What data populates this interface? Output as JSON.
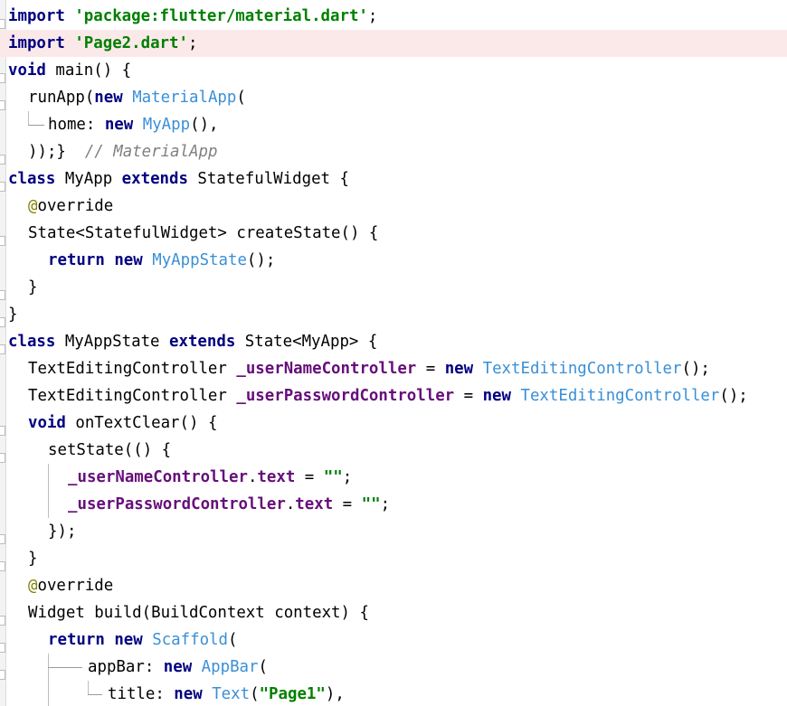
{
  "lines": [
    {
      "indent": 0,
      "highlight": false,
      "segs": [
        {
          "t": "kw",
          "v": "import"
        },
        {
          "t": "plain",
          "v": " "
        },
        {
          "t": "str",
          "v": "'package:flutter/material.dart'"
        },
        {
          "t": "plain",
          "v": ";"
        }
      ]
    },
    {
      "indent": 0,
      "highlight": true,
      "segs": [
        {
          "t": "kw",
          "v": "import"
        },
        {
          "t": "plain",
          "v": " "
        },
        {
          "t": "str",
          "v": "'Page2.dart'"
        },
        {
          "t": "plain",
          "v": ";"
        }
      ]
    },
    {
      "indent": 0,
      "highlight": false,
      "segs": [
        {
          "t": "kw",
          "v": "void"
        },
        {
          "t": "plain",
          "v": " main() {"
        }
      ]
    },
    {
      "indent": 1,
      "highlight": false,
      "segs": [
        {
          "t": "plain",
          "v": "runApp("
        },
        {
          "t": "kw",
          "v": "new"
        },
        {
          "t": "plain",
          "v": " "
        },
        {
          "t": "cls",
          "v": "MaterialApp"
        },
        {
          "t": "plain",
          "v": "("
        }
      ]
    },
    {
      "indent": 2,
      "highlight": false,
      "segs": [
        {
          "t": "plain",
          "v": "home: "
        },
        {
          "t": "kw",
          "v": "new"
        },
        {
          "t": "plain",
          "v": " "
        },
        {
          "t": "cls",
          "v": "MyApp"
        },
        {
          "t": "plain",
          "v": "(),"
        }
      ]
    },
    {
      "indent": 1,
      "highlight": false,
      "segs": [
        {
          "t": "plain",
          "v": "));}  "
        },
        {
          "t": "cmt",
          "v": "// MaterialApp"
        }
      ]
    },
    {
      "indent": 0,
      "highlight": false,
      "segs": [
        {
          "t": "kw",
          "v": "class"
        },
        {
          "t": "plain",
          "v": " MyApp "
        },
        {
          "t": "kw",
          "v": "extends"
        },
        {
          "t": "plain",
          "v": " StatefulWidget {"
        }
      ]
    },
    {
      "indent": 1,
      "highlight": false,
      "segs": [
        {
          "t": "ann",
          "v": "@"
        },
        {
          "t": "plain",
          "v": "override"
        }
      ]
    },
    {
      "indent": 1,
      "highlight": false,
      "segs": [
        {
          "t": "plain",
          "v": "State<StatefulWidget> createState() {"
        }
      ]
    },
    {
      "indent": 2,
      "highlight": false,
      "segs": [
        {
          "t": "kw",
          "v": "return"
        },
        {
          "t": "plain",
          "v": " "
        },
        {
          "t": "kw",
          "v": "new"
        },
        {
          "t": "plain",
          "v": " "
        },
        {
          "t": "cls",
          "v": "MyAppState"
        },
        {
          "t": "plain",
          "v": "();"
        }
      ]
    },
    {
      "indent": 1,
      "highlight": false,
      "segs": [
        {
          "t": "plain",
          "v": "}"
        }
      ]
    },
    {
      "indent": 0,
      "highlight": false,
      "segs": [
        {
          "t": "plain",
          "v": "}"
        }
      ]
    },
    {
      "indent": 0,
      "highlight": false,
      "segs": [
        {
          "t": "kw",
          "v": "class"
        },
        {
          "t": "plain",
          "v": " MyAppState "
        },
        {
          "t": "kw",
          "v": "extends"
        },
        {
          "t": "plain",
          "v": " State<MyApp> {"
        }
      ]
    },
    {
      "indent": 1,
      "highlight": false,
      "segs": [
        {
          "t": "plain",
          "v": "TextEditingController "
        },
        {
          "t": "fld",
          "v": "_userNameController"
        },
        {
          "t": "plain",
          "v": " = "
        },
        {
          "t": "kw",
          "v": "new"
        },
        {
          "t": "plain",
          "v": " "
        },
        {
          "t": "cls",
          "v": "TextEditingController"
        },
        {
          "t": "plain",
          "v": "();"
        }
      ]
    },
    {
      "indent": 1,
      "highlight": false,
      "segs": [
        {
          "t": "plain",
          "v": "TextEditingController "
        },
        {
          "t": "fld",
          "v": "_userPasswordController"
        },
        {
          "t": "plain",
          "v": " = "
        },
        {
          "t": "kw",
          "v": "new"
        },
        {
          "t": "plain",
          "v": " "
        },
        {
          "t": "cls",
          "v": "TextEditingController"
        },
        {
          "t": "plain",
          "v": "();"
        }
      ]
    },
    {
      "indent": 1,
      "highlight": false,
      "segs": [
        {
          "t": "kw",
          "v": "void"
        },
        {
          "t": "plain",
          "v": " onTextClear() {"
        }
      ]
    },
    {
      "indent": 2,
      "highlight": false,
      "segs": [
        {
          "t": "plain",
          "v": "setState(() {"
        }
      ]
    },
    {
      "indent": 3,
      "highlight": false,
      "segs": [
        {
          "t": "fld",
          "v": "_userNameController"
        },
        {
          "t": "plain",
          "v": "."
        },
        {
          "t": "fld",
          "v": "text"
        },
        {
          "t": "plain",
          "v": " = "
        },
        {
          "t": "str",
          "v": "\"\""
        },
        {
          "t": "plain",
          "v": ";"
        }
      ]
    },
    {
      "indent": 3,
      "highlight": false,
      "segs": [
        {
          "t": "fld",
          "v": "_userPasswordController"
        },
        {
          "t": "plain",
          "v": "."
        },
        {
          "t": "fld",
          "v": "text"
        },
        {
          "t": "plain",
          "v": " = "
        },
        {
          "t": "str",
          "v": "\"\""
        },
        {
          "t": "plain",
          "v": ";"
        }
      ]
    },
    {
      "indent": 2,
      "highlight": false,
      "segs": [
        {
          "t": "plain",
          "v": "});"
        }
      ]
    },
    {
      "indent": 1,
      "highlight": false,
      "segs": [
        {
          "t": "plain",
          "v": "}"
        }
      ]
    },
    {
      "indent": 1,
      "highlight": false,
      "segs": [
        {
          "t": "ann",
          "v": "@"
        },
        {
          "t": "plain",
          "v": "override"
        }
      ]
    },
    {
      "indent": 1,
      "highlight": false,
      "segs": [
        {
          "t": "plain",
          "v": "Widget build(BuildContext context) {"
        }
      ]
    },
    {
      "indent": 2,
      "highlight": false,
      "segs": [
        {
          "t": "kw",
          "v": "return"
        },
        {
          "t": "plain",
          "v": " "
        },
        {
          "t": "kw",
          "v": "new"
        },
        {
          "t": "plain",
          "v": " "
        },
        {
          "t": "cls",
          "v": "Scaffold"
        },
        {
          "t": "plain",
          "v": "("
        }
      ]
    },
    {
      "indent": 4,
      "highlight": false,
      "segs": [
        {
          "t": "plain",
          "v": "appBar: "
        },
        {
          "t": "kw",
          "v": "new"
        },
        {
          "t": "plain",
          "v": " "
        },
        {
          "t": "cls",
          "v": "AppBar"
        },
        {
          "t": "plain",
          "v": "("
        }
      ]
    },
    {
      "indent": 5,
      "highlight": false,
      "segs": [
        {
          "t": "plain",
          "v": "title: "
        },
        {
          "t": "kw",
          "v": "new"
        },
        {
          "t": "plain",
          "v": " "
        },
        {
          "t": "cls",
          "v": "Text"
        },
        {
          "t": "plain",
          "v": "("
        },
        {
          "t": "str",
          "v": "\"Page1\""
        },
        {
          "t": "plain",
          "v": "),"
        }
      ]
    }
  ],
  "colors": {
    "keyword": "#000080",
    "string": "#008000",
    "class_ref": "#3a8fd6",
    "field": "#660e7a",
    "comment": "#808080",
    "annotation": "#808000",
    "highlight_line": "#fbe9e9"
  }
}
